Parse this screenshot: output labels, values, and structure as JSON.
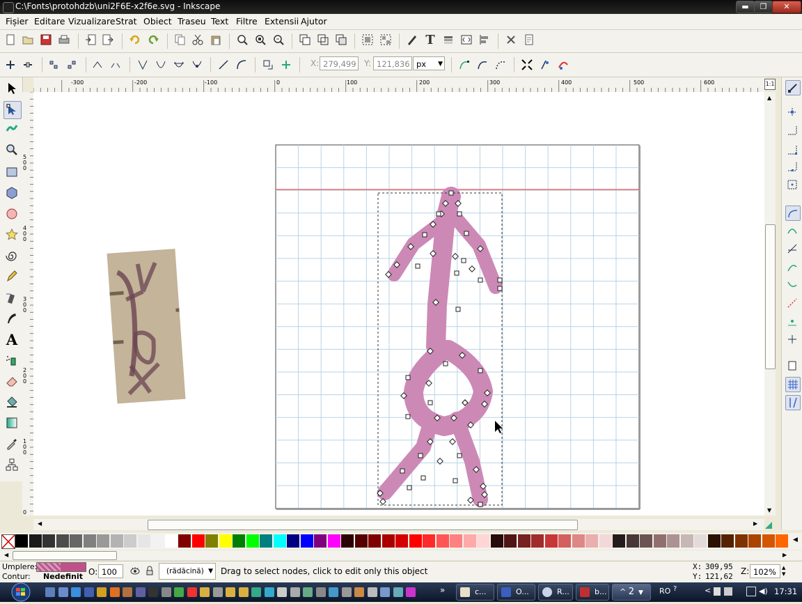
{
  "window": {
    "title": "C:\\Fonts\\protohdzb\\uni2F6E-x2f6e.svg - Inkscape",
    "buttons": {
      "minimize": "▬",
      "maximize": "❐",
      "close": "✕"
    }
  },
  "menu": [
    "Fișier",
    "Editare",
    "Vizualizare",
    "Strat",
    "Obiect",
    "Traseu",
    "Text",
    "Filtre",
    "Extensii",
    "Ajutor"
  ],
  "toolbar_icons": [
    "new-doc-icon",
    "open-icon",
    "save-icon",
    "print-icon",
    "import-icon",
    "export-icon",
    "undo-icon",
    "redo-icon",
    "copy-icon",
    "cut-icon",
    "paste-icon",
    "zoom-selection-icon",
    "zoom-drawing-icon",
    "zoom-page-icon",
    "duplicate-icon",
    "clone-icon",
    "unlink-clone-icon",
    "group-icon",
    "ungroup-icon",
    "fill-stroke-icon",
    "text-font-icon",
    "layers-icon",
    "xml-editor-icon",
    "align-icon",
    "preferences-icon",
    "document-properties-icon"
  ],
  "node_toolbar": {
    "x_label": "X:",
    "x_value": "279,499",
    "y_label": "Y:",
    "y_value": "121,836",
    "unit": "px"
  },
  "ruler": {
    "h_labels": [
      "-300",
      "-200",
      "-100",
      "0",
      "100",
      "200",
      "300",
      "400",
      "500",
      "600"
    ],
    "v_labels": [
      "500",
      "400",
      "300",
      "200",
      "100",
      "0"
    ],
    "zoom_corner": "1:1"
  },
  "status": {
    "fill_label": "Umplere:",
    "stroke_label": "Contur:",
    "stroke_value": "Nedefinit",
    "opacity_label": "O:",
    "opacity_value": "100",
    "layer": "(rădăcină)",
    "message": "Drag to select nodes, click to edit only this object",
    "cursor_x_label": "X:",
    "cursor_x": "309,95",
    "cursor_y_label": "Y:",
    "cursor_y": "121,62",
    "zoom_label": "Z:",
    "zoom_value": "102%"
  },
  "taskbar": {
    "tasks": [
      "c...",
      "O...",
      "R...",
      "b..."
    ],
    "group_count": "2",
    "language": "RO",
    "clock": "17:31"
  },
  "colors": {
    "glyph_fill": "#cc89b6",
    "guide": "#e8524f",
    "grid": "#b8d3e6",
    "fill_swatch": "#c0508a"
  },
  "palette": [
    "#000000",
    "#1a1a1a",
    "#333333",
    "#4d4d4d",
    "#666666",
    "#808080",
    "#999999",
    "#b3b3b3",
    "#cccccc",
    "#e6e6e6",
    "#f2f2f2",
    "#ffffff",
    "#800000",
    "#ff0000",
    "#808000",
    "#ffff00",
    "#008000",
    "#00ff00",
    "#008080",
    "#00ffff",
    "#000080",
    "#0000ff",
    "#800080",
    "#ff00ff",
    "#2b0000",
    "#550000",
    "#800000",
    "#aa0000",
    "#d40000",
    "#ff0000",
    "#ff2a2a",
    "#ff5555",
    "#ff8080",
    "#ffaaaa",
    "#ffd5d5",
    "#280b0b",
    "#501616",
    "#782121",
    "#a02c2c",
    "#c83737",
    "#d35f5f",
    "#de8787",
    "#e9afaf",
    "#f4d7d7",
    "#241c1c",
    "#483737",
    "#6c5353",
    "#916f6f",
    "#ac9393",
    "#c8b7b7",
    "#e3dbdb",
    "#2b1100",
    "#552200",
    "#803300",
    "#aa4400",
    "#d45500",
    "#ff6600"
  ]
}
